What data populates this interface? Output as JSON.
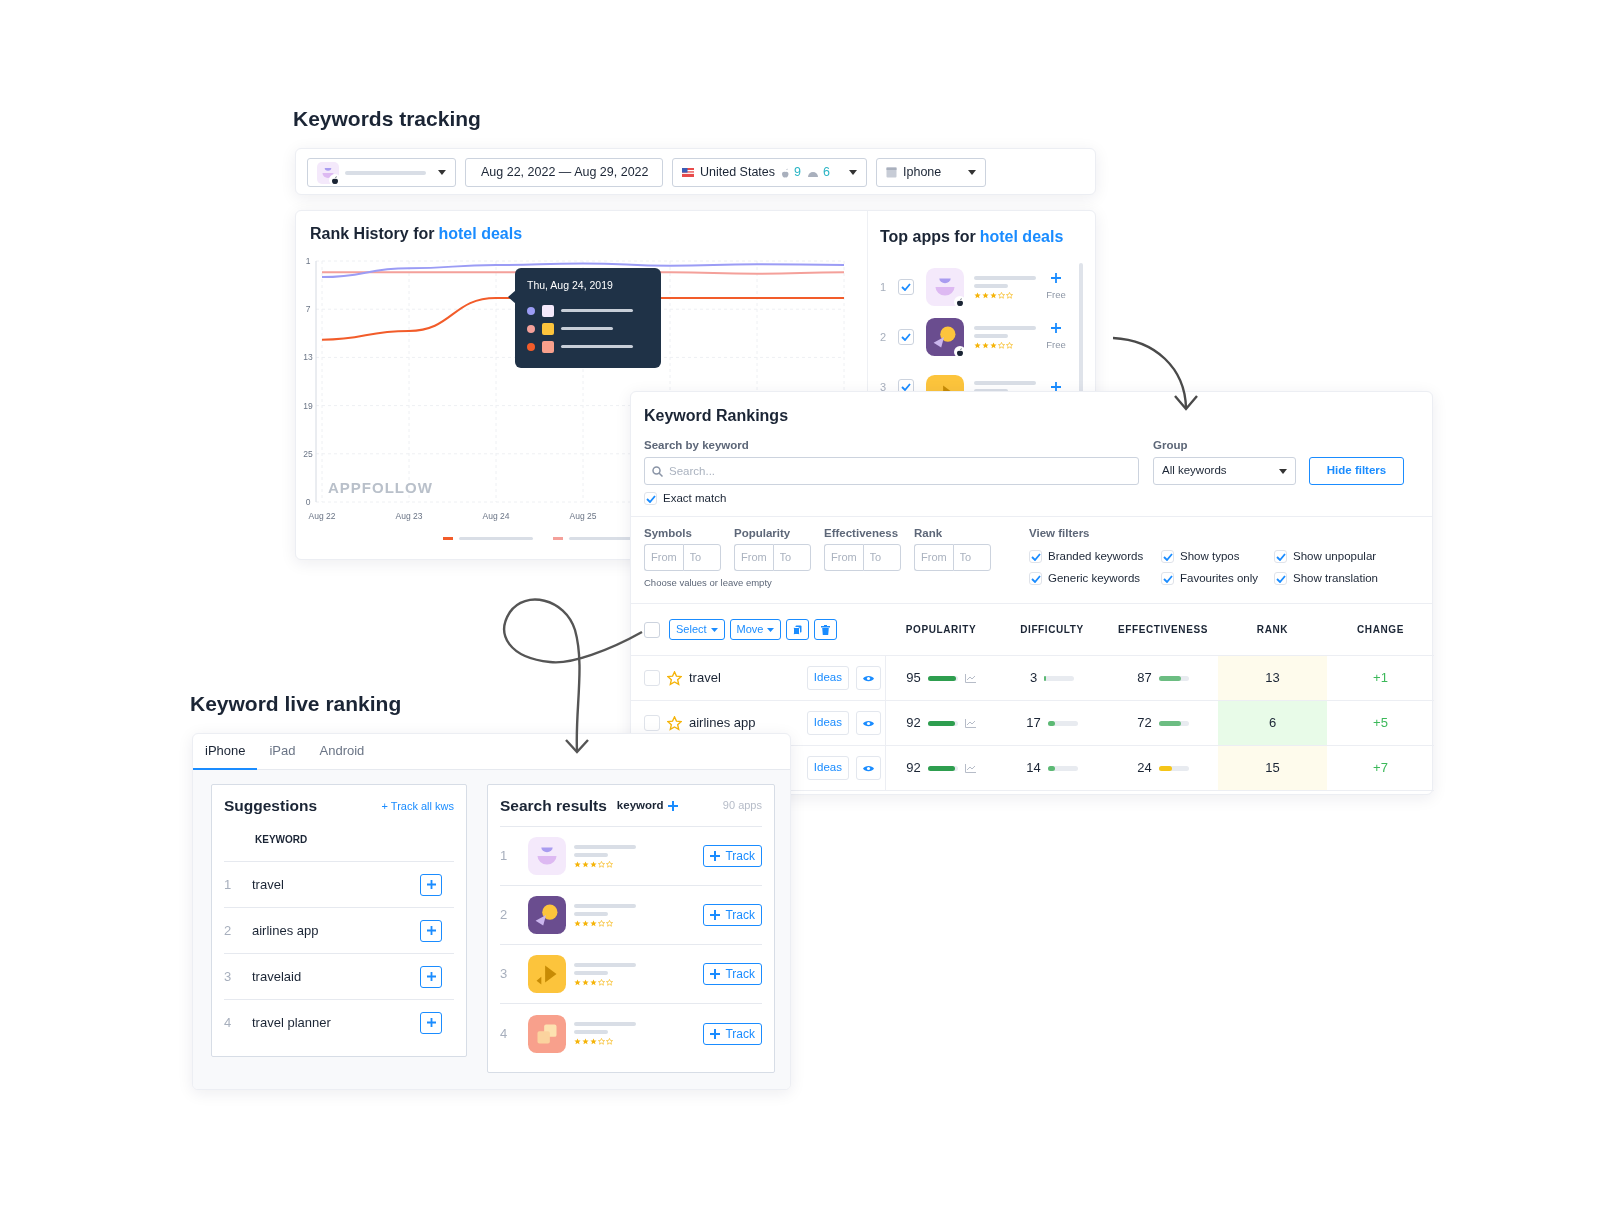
{
  "page_title": "Keywords tracking",
  "filters": {
    "date_range": "Aug 22, 2022 — Aug 29, 2022",
    "country": "United States",
    "ios_count": "9",
    "android_count": "6",
    "device": "Iphone"
  },
  "rank_history": {
    "title": "Rank History for",
    "keyword": "hotel deals",
    "brand": "APPFOLLOW",
    "chart_data": {
      "type": "line",
      "grid": true,
      "categories": [
        "Aug 22",
        "Aug 23",
        "Aug 24",
        "Aug 25",
        null,
        null,
        null
      ],
      "yticks": [
        1,
        7,
        13,
        19,
        25
      ],
      "ylim": [
        31,
        1
      ],
      "series": [
        {
          "color": "#f25c2a",
          "values": [
            10.8,
            9.7,
            5.6,
            null,
            5.6,
            5.6,
            5.6
          ]
        },
        {
          "color": "#f4a09a",
          "values": [
            2.4,
            2.4,
            2.4,
            null,
            2.4,
            2.6,
            2.4
          ]
        },
        {
          "color": "#9b9cf5",
          "values": [
            3.0,
            1.9,
            1.5,
            1.3,
            1.6,
            1.4,
            1.5
          ]
        }
      ]
    },
    "y_bottom_label": "0",
    "tooltip": {
      "title": "Thu, Aug 24, 2019"
    }
  },
  "top_apps": {
    "title": "Top apps for",
    "keyword": "hotel deals",
    "apps": [
      {
        "rank": "1",
        "checked": true,
        "stars": 3,
        "price": "Free"
      },
      {
        "rank": "2",
        "checked": true,
        "stars": 3,
        "price": "Free"
      },
      {
        "rank": "3",
        "checked": true
      }
    ]
  },
  "keyword_rankings": {
    "title": "Keyword Rankings",
    "search_label": "Search by keyword",
    "search_placeholder": "Search...",
    "group_label": "Group",
    "group_value": "All keywords",
    "hide_filters": "Hide filters",
    "exact_match": {
      "label": "Exact match",
      "checked": true
    },
    "range_filters": [
      {
        "label": "Symbols",
        "from_placeholder": "From",
        "to_placeholder": "To"
      },
      {
        "label": "Popularity",
        "from_placeholder": "From",
        "to_placeholder": "To"
      },
      {
        "label": "Effectiveness",
        "from_placeholder": "From",
        "to_placeholder": "To"
      },
      {
        "label": "Rank",
        "from_placeholder": "From",
        "to_placeholder": "To"
      }
    ],
    "hint": "Choose values or leave empty",
    "view_filters_label": "View filters",
    "view_filters": [
      {
        "label": "Branded keywords",
        "checked": true
      },
      {
        "label": "Show typos",
        "checked": true
      },
      {
        "label": "Show unpopular",
        "checked": true
      },
      {
        "label": "Generic keywords",
        "checked": true
      },
      {
        "label": "Favourites only",
        "checked": true
      },
      {
        "label": "Show translation",
        "checked": true
      }
    ],
    "select_all_checked": false,
    "select_label": "Select",
    "move_label": "Move",
    "columns": [
      "POPULARITY",
      "DIFFICULTY",
      "EFFECTIVENESS",
      "RANK",
      "CHANGE"
    ],
    "rows": [
      {
        "keyword": "travel",
        "checked": false,
        "starred": false,
        "ideas": "Ideas",
        "popularity": {
          "value": "95",
          "level": 0.95
        },
        "difficulty": {
          "value": "3",
          "level": 0.06
        },
        "effectiveness": {
          "value": "87",
          "level": 0.75,
          "color": "#6cbd82"
        },
        "rank": {
          "value": "13",
          "color": "#fefbec"
        },
        "change": "+1"
      },
      {
        "keyword": "airlines app",
        "checked": false,
        "starred": false,
        "ideas": "Ideas",
        "popularity": {
          "value": "92",
          "level": 0.9
        },
        "difficulty": {
          "value": "17",
          "level": 0.25
        },
        "effectiveness": {
          "value": "72",
          "level": 0.75,
          "color": "#6cbd82"
        },
        "rank": {
          "value": "6",
          "color": "#e8fbe8"
        },
        "change": "+5"
      },
      {
        "ideas": "Ideas",
        "popularity": {
          "value": "92",
          "level": 0.9
        },
        "difficulty": {
          "value": "14",
          "level": 0.25
        },
        "effectiveness": {
          "value": "24",
          "level": 0.45,
          "color": "#f5c518"
        },
        "rank": {
          "value": "15",
          "color": "#fefbec"
        },
        "change": "+7"
      }
    ]
  },
  "live_ranking": {
    "title": "Keyword live ranking",
    "tabs": [
      {
        "label": "iPhone",
        "selected": true
      },
      {
        "label": "iPad",
        "selected": false
      },
      {
        "label": "Android",
        "selected": false
      }
    ],
    "suggestions": {
      "title": "Suggestions",
      "track_all": "+ Track all kws",
      "column": "KEYWORD",
      "items": [
        {
          "rank": "1",
          "keyword": "travel"
        },
        {
          "rank": "2",
          "keyword": "airlines app"
        },
        {
          "rank": "3",
          "keyword": "travelaid"
        },
        {
          "rank": "4",
          "keyword": "travel planner"
        }
      ]
    },
    "search_results": {
      "title": "Search results",
      "keyword_label": "keyword",
      "count": "90 apps",
      "apps": [
        {
          "rank": "1",
          "stars": 3,
          "action": "Track"
        },
        {
          "rank": "2",
          "stars": 3,
          "action": "Track"
        },
        {
          "rank": "3",
          "stars": 3,
          "action": "Track"
        },
        {
          "rank": "4",
          "stars": 3,
          "action": "Track"
        }
      ]
    }
  }
}
